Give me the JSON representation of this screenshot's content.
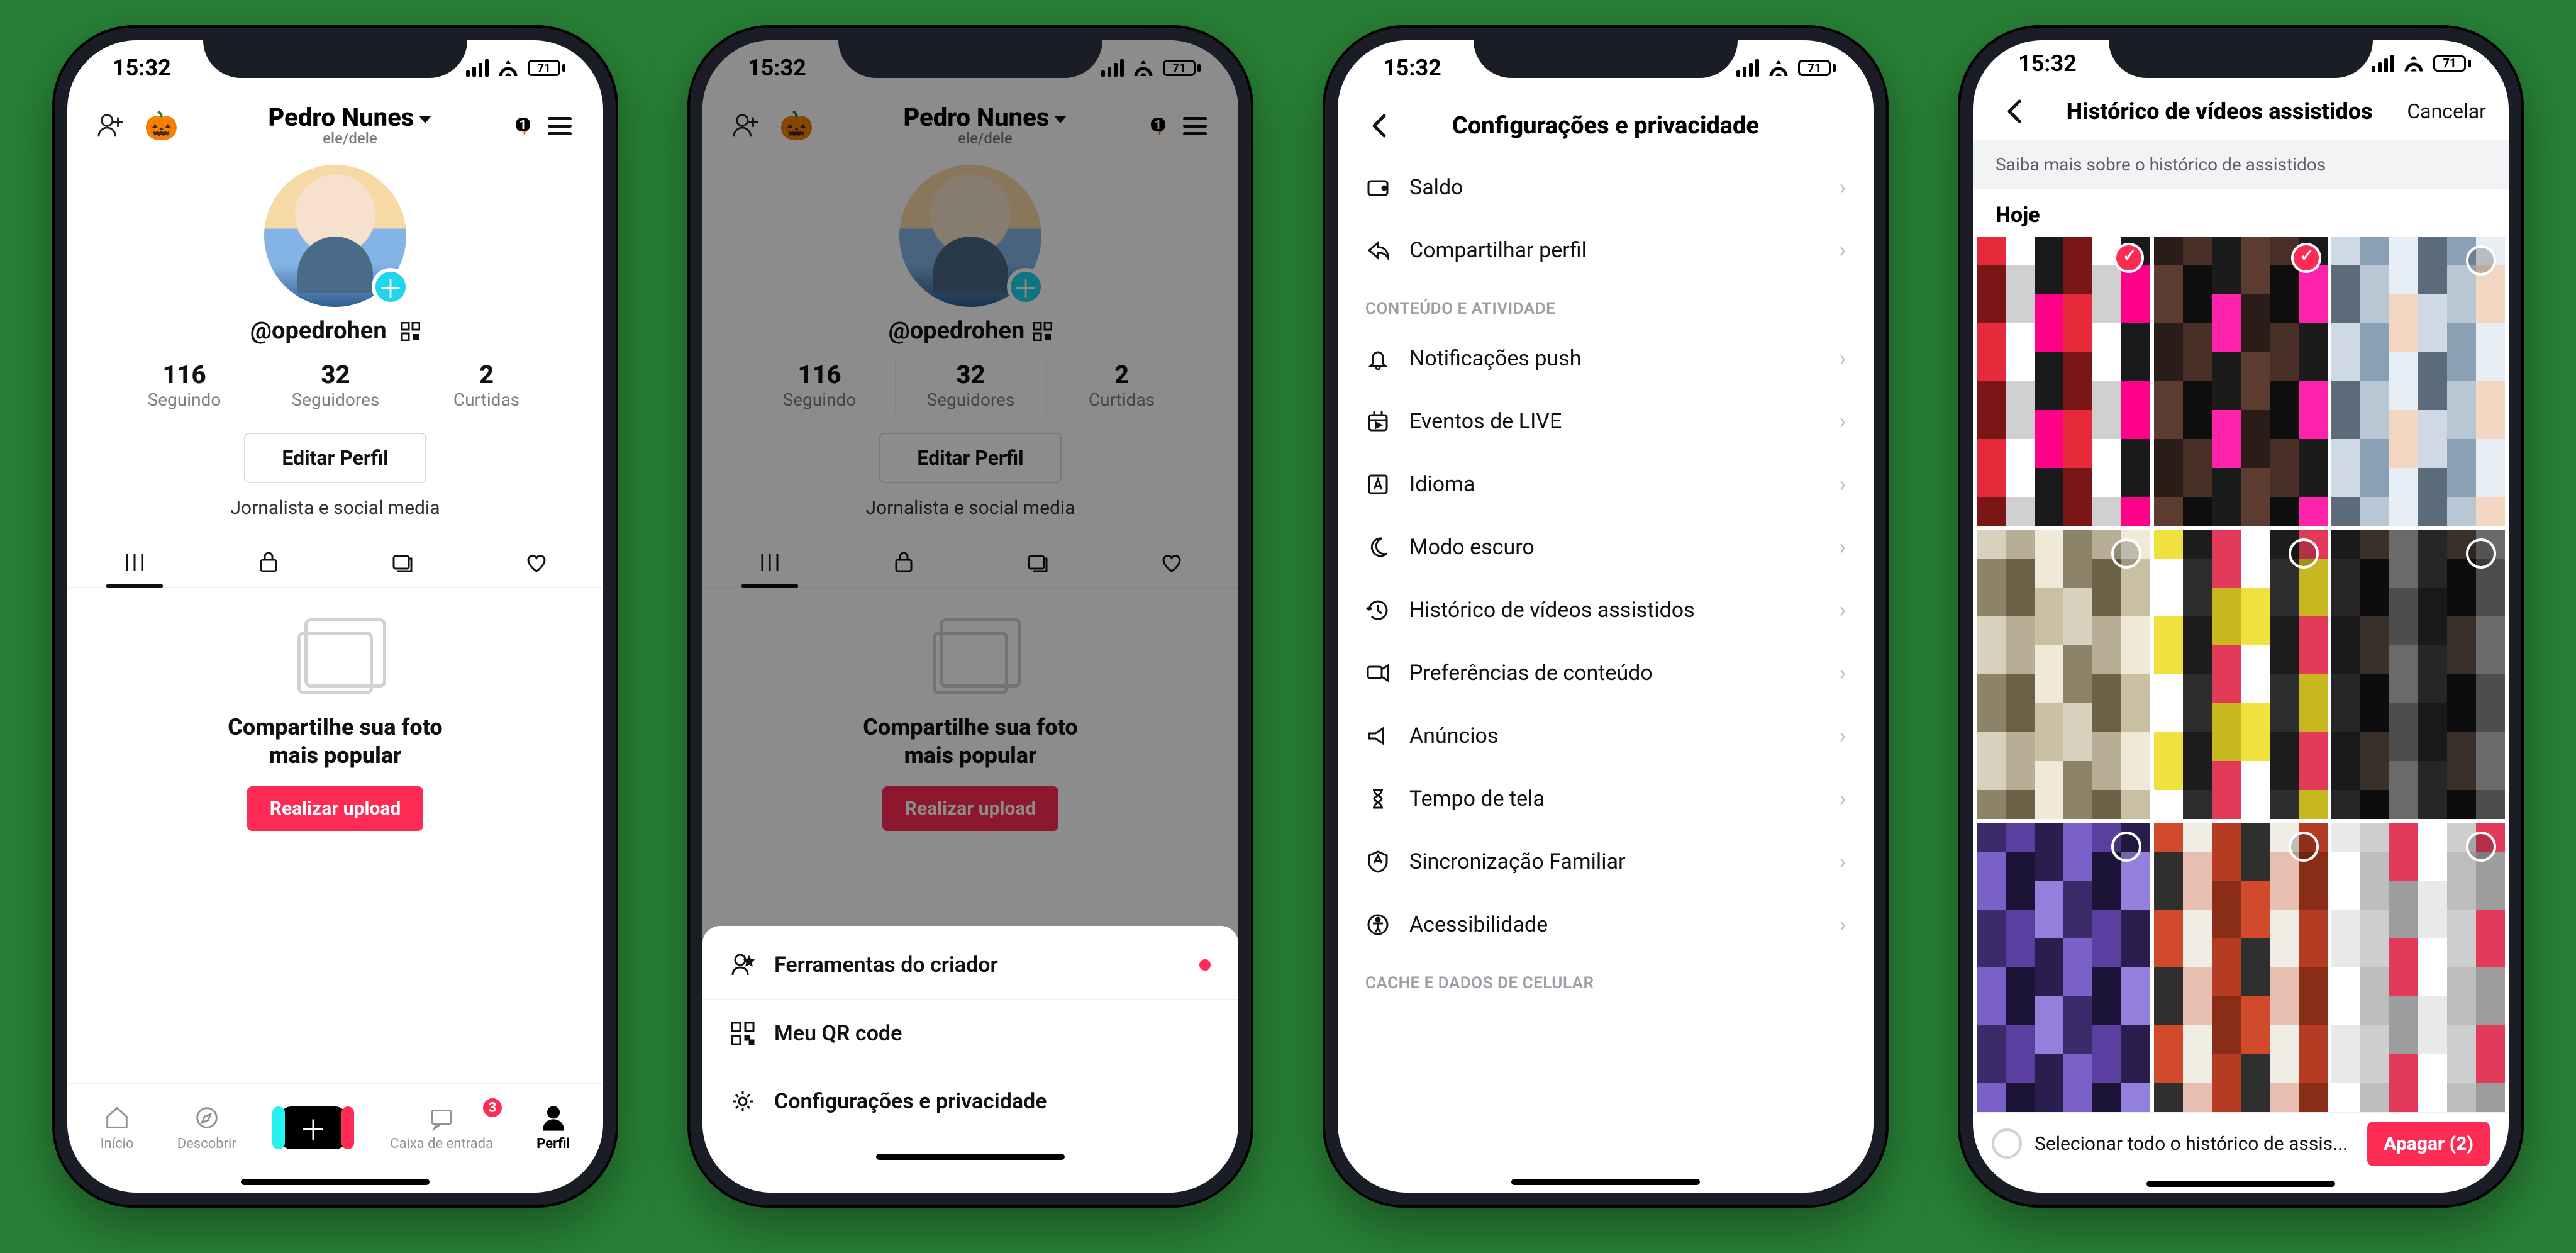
{
  "status": {
    "time": "15:32",
    "battery": "71"
  },
  "profile": {
    "name": "Pedro Nunes",
    "pronouns": "ele/dele",
    "handle": "@opedrohen",
    "story_count": "1",
    "stats": {
      "following_num": "116",
      "following_lbl": "Seguindo",
      "followers_num": "32",
      "followers_lbl": "Seguidores",
      "likes_num": "2",
      "likes_lbl": "Curtidas"
    },
    "edit_btn": "Editar Perfil",
    "bio": "Jornalista e social media",
    "empty_title_l1": "Compartilhe sua foto",
    "empty_title_l2": "mais popular",
    "upload_btn": "Realizar upload"
  },
  "tabbar": {
    "home": "Início",
    "discover": "Descobrir",
    "inbox": "Caixa de entrada",
    "inbox_badge": "3",
    "profile": "Perfil"
  },
  "sheet": {
    "creator_tools": "Ferramentas do criador",
    "qr": "Meu QR code",
    "settings": "Configurações e privacidade"
  },
  "settings": {
    "title": "Configurações e privacidade",
    "balance": "Saldo",
    "share_profile": "Compartilhar perfil",
    "section_content": "CONTEÚDO E ATIVIDADE",
    "push": "Notificações push",
    "live": "Eventos de LIVE",
    "lang": "Idioma",
    "dark": "Modo escuro",
    "history": "Histórico de vídeos assistidos",
    "prefs": "Preferências de conteúdo",
    "ads": "Anúncios",
    "screen_time": "Tempo de tela",
    "family": "Sincronização Familiar",
    "a11y": "Acessibilidade",
    "section_cache": "CACHE E DADOS DE CELULAR"
  },
  "history": {
    "title": "Histórico de vídeos assistidos",
    "cancel": "Cancelar",
    "banner": "Saiba mais sobre o histórico de assistidos",
    "today": "Hoje",
    "select_all": "Selecionar todo o histórico de assis...",
    "delete": "Apagar (2)"
  }
}
